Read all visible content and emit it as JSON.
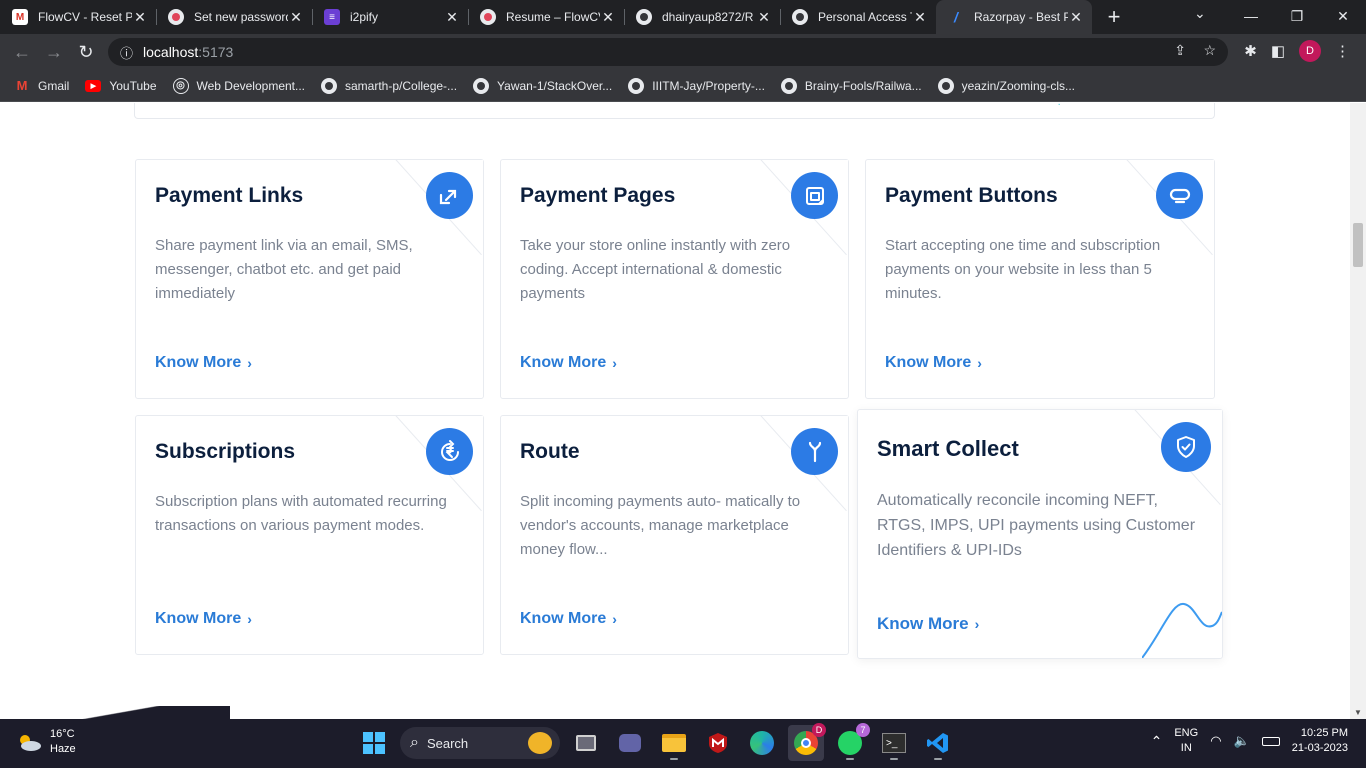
{
  "browser": {
    "tabs": [
      {
        "title": "FlowCV - Reset Pa",
        "icon": "gmail-icon"
      },
      {
        "title": "Set new password",
        "icon": "flowcv-icon"
      },
      {
        "title": "i2pify",
        "icon": "i2pify-icon"
      },
      {
        "title": "Resume – FlowCV",
        "icon": "flowcv-icon"
      },
      {
        "title": "dhairyaup8272/R",
        "icon": "github-icon"
      },
      {
        "title": "Personal Access T",
        "icon": "github-icon"
      },
      {
        "title": "Razorpay - Best P",
        "icon": "razorpay-icon",
        "active": true
      }
    ],
    "url_host": "localhost",
    "url_port": ":5173",
    "profile_initial": "D",
    "bookmarks": [
      {
        "label": "Gmail",
        "icon": "gmail-icon"
      },
      {
        "label": "YouTube",
        "icon": "youtube-icon"
      },
      {
        "label": "Web Development...",
        "icon": "globe-icon"
      },
      {
        "label": "samarth-p/College-...",
        "icon": "github-icon"
      },
      {
        "label": "Yawan-1/StackOver...",
        "icon": "github-icon"
      },
      {
        "label": "IIITM-Jay/Property-...",
        "icon": "github-icon"
      },
      {
        "label": "Brainy-Fools/Railwa...",
        "icon": "github-icon"
      },
      {
        "label": "yeazin/Zooming-cls...",
        "icon": "github-icon"
      }
    ]
  },
  "products": [
    {
      "title": "Payment Links",
      "desc": "Share payment link via an email, SMS, messenger, chatbot etc. and get paid immediately",
      "more": "Know More",
      "icon": "link-arrows-icon"
    },
    {
      "title": "Payment Pages",
      "desc": "Take your store online instantly with zero coding. Accept international & domestic payments",
      "more": "Know More",
      "icon": "page-icon"
    },
    {
      "title": "Payment Buttons",
      "desc": "Start accepting one time and subscription payments on your website in less than 5 minutes.",
      "more": "Know More",
      "icon": "button-icon"
    },
    {
      "title": "Subscriptions",
      "desc": "Subscription plans with automated recurring transactions on various payment modes.",
      "more": "Know More",
      "icon": "rupee-cycle-icon"
    },
    {
      "title": "Route",
      "desc": "Split incoming payments auto- matically to vendor's accounts, manage marketplace money flow...",
      "more": "Know More",
      "icon": "split-route-icon"
    },
    {
      "title": "Smart Collect",
      "desc": "Automatically reconcile incoming NEFT, RTGS, IMPS, UPI payments using Customer Identifiers & UPI-IDs",
      "more": "Know More",
      "icon": "shield-check-icon"
    }
  ],
  "taskbar": {
    "weather_temp": "16°C",
    "weather_desc": "Haze",
    "search_label": "Search",
    "whatsapp_badge": "7",
    "lang_top": "ENG",
    "lang_bottom": "IN",
    "time": "10:25 PM",
    "date": "21-03-2023"
  },
  "colors": {
    "accent": "#2c7be5",
    "link": "#2a7bd6",
    "title": "#0c1f3d"
  }
}
